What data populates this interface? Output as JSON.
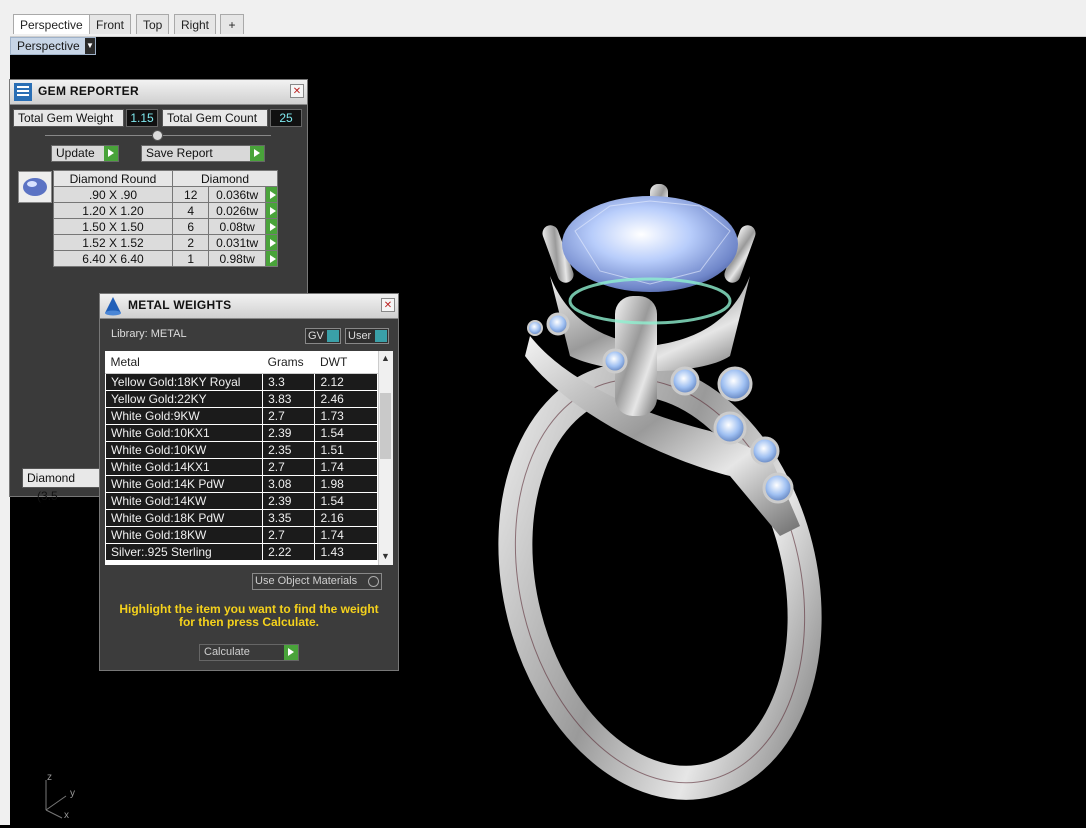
{
  "tabs": [
    "Perspective",
    "Front",
    "Top",
    "Right",
    "+"
  ],
  "viewport_label": "Perspective",
  "gem_reporter": {
    "title": "GEM REPORTER",
    "total_weight_label": "Total Gem Weight",
    "total_weight_value": "1.15",
    "total_count_label": "Total Gem Count",
    "total_count_value": "25",
    "update_label": "Update",
    "save_label": "Save Report",
    "col_shape": "Diamond Round",
    "col_type": "Diamond",
    "rows": [
      {
        "size": ".90 X .90",
        "count": "12",
        "tw": "0.036tw"
      },
      {
        "size": "1.20 X 1.20",
        "count": "4",
        "tw": "0.026tw"
      },
      {
        "size": "1.50 X 1.50",
        "count": "6",
        "tw": "0.08tw"
      },
      {
        "size": "1.52 X 1.52",
        "count": "2",
        "tw": "0.031tw"
      },
      {
        "size": "6.40 X 6.40",
        "count": "1",
        "tw": "0.98tw"
      }
    ],
    "footer_text": "Diamond",
    "footer_extra": "(3.5"
  },
  "metal_weights": {
    "title": "METAL WEIGHTS",
    "library": "Library: METAL",
    "gv_label": "GV",
    "user_label": "User",
    "columns": [
      "Metal",
      "Grams",
      "DWT"
    ],
    "rows": [
      {
        "metal": "Yellow Gold:18KY Royal",
        "grams": "3.3",
        "dwt": "2.12"
      },
      {
        "metal": "Yellow Gold:22KY",
        "grams": "3.83",
        "dwt": "2.46"
      },
      {
        "metal": "White Gold:9KW",
        "grams": "2.7",
        "dwt": "1.73"
      },
      {
        "metal": "White Gold:10KX1",
        "grams": "2.39",
        "dwt": "1.54"
      },
      {
        "metal": "White Gold:10KW",
        "grams": "2.35",
        "dwt": "1.51"
      },
      {
        "metal": "White Gold:14KX1",
        "grams": "2.7",
        "dwt": "1.74"
      },
      {
        "metal": "White Gold:14K PdW",
        "grams": "3.08",
        "dwt": "1.98"
      },
      {
        "metal": "White Gold:14KW",
        "grams": "2.39",
        "dwt": "1.54"
      },
      {
        "metal": "White Gold:18K PdW",
        "grams": "3.35",
        "dwt": "2.16"
      },
      {
        "metal": "White Gold:18KW",
        "grams": "2.7",
        "dwt": "1.74"
      },
      {
        "metal": "Silver:.925 Sterling",
        "grams": "2.22",
        "dwt": "1.43"
      }
    ],
    "use_object_materials": "Use Object Materials",
    "instruction_line1": "Highlight the item you want to find the weight",
    "instruction_line2": "for then press Calculate.",
    "calculate_label": "Calculate"
  },
  "axes": {
    "z": "z",
    "y": "y",
    "x": "x"
  },
  "colors": {
    "viewport_bg": "#000000",
    "accent_green": "#49a33a",
    "value_cyan": "#7ee8ee",
    "hint_yellow": "#f5d21c"
  }
}
